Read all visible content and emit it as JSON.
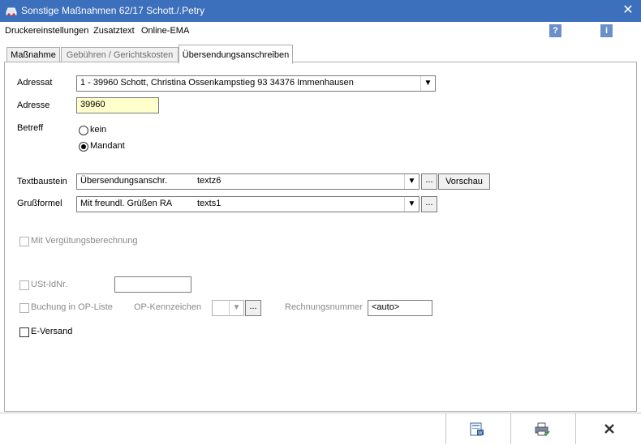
{
  "window": {
    "title": "Sonstige Maßnahmen  62/17 Schott./.Petry",
    "app_icon": "car-icon",
    "close_icon": "close-icon"
  },
  "menu": [
    "Druckereinstellungen",
    "Zusatztext",
    "Online-EMA"
  ],
  "menu_icons": {
    "help": "?",
    "info": "i"
  },
  "tabs": [
    {
      "label": "Maßnahme",
      "state": "normal"
    },
    {
      "label": "Gebühren / Gerichtskosten",
      "state": "disabled"
    },
    {
      "label": "Übersendungsanschreiben",
      "state": "active"
    }
  ],
  "form": {
    "adressat_label": "Adressat",
    "adressat_value": "1 - 39960 Schott, Christina  Ossenkampstieg 93 34376 Immenhausen",
    "adresse_label": "Adresse",
    "adresse_value": "39960",
    "betreff_label": "Betreff",
    "betreff_options": [
      "kein",
      "Mandant"
    ],
    "betreff_selected": "Mandant",
    "textbaustein_label": "Textbaustein",
    "textbaustein_name": "Übersendungsanschr.",
    "textbaustein_code": "textz6",
    "vorschau_label": "Vorschau",
    "grussformel_label": "Grußformel",
    "grussformel_name": "Mit freundl. Grüßen RA",
    "grussformel_code": "texts1",
    "dots_label": "...",
    "verguetung_label": "Mit Vergütungsberechnung",
    "ustid_label": "USt-IdNr.",
    "ustid_value": "",
    "buchung_label": "Buchung in OP-Liste",
    "op_kennzeichen_label": "OP-Kennzeichen",
    "rechnungsnummer_label": "Rechnungsnummer",
    "rechnungsnummer_value": "<auto>",
    "eversand_label": "E-Versand"
  },
  "footer": {
    "buttons": [
      "word-document-icon",
      "print-icon",
      "cancel-icon"
    ]
  },
  "colors": {
    "titlebar": "#3c6fbc",
    "adresse_field_bg": "#ffffcc"
  }
}
